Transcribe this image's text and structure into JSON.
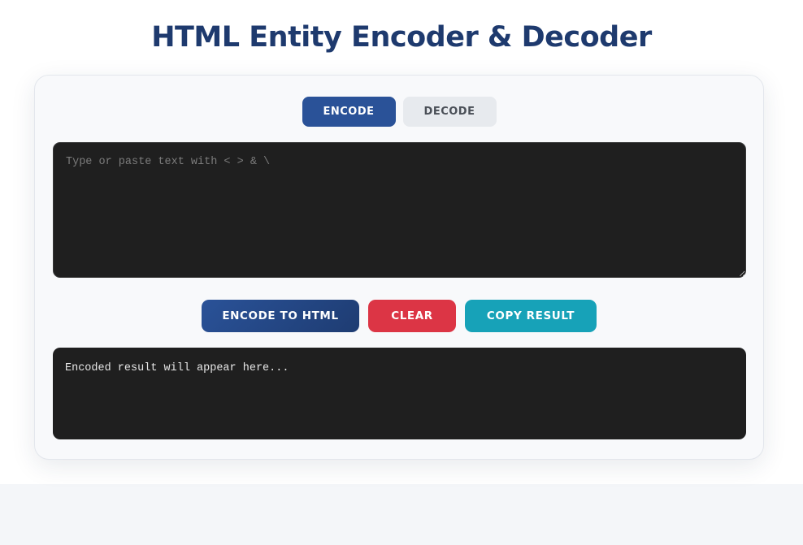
{
  "header": {
    "title": "HTML Entity Encoder & Decoder"
  },
  "tabs": {
    "encode_label": "ENCODE",
    "decode_label": "DECODE",
    "active": "encode"
  },
  "input": {
    "value": "",
    "placeholder": "Type or paste text with < > & \\"
  },
  "actions": {
    "encode_label": "ENCODE TO HTML",
    "clear_label": "CLEAR",
    "copy_label": "COPY RESULT"
  },
  "output": {
    "text": "Encoded result will appear here..."
  },
  "colors": {
    "title": "#1e3a6e",
    "primary": "#2a5298",
    "danger": "#dc3545",
    "info": "#17a2b8",
    "editor_bg": "#1f1f1f"
  }
}
